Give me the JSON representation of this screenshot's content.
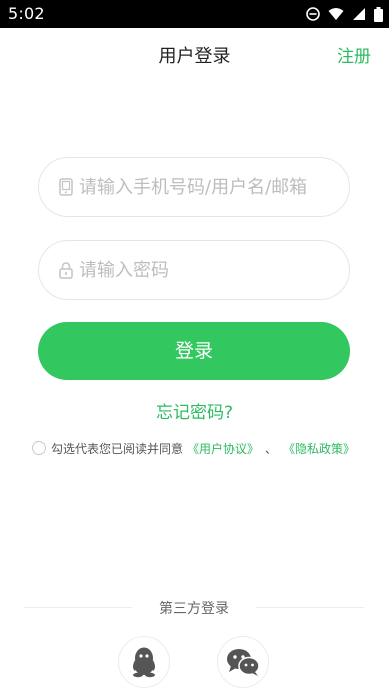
{
  "status_bar": {
    "time": "5:02",
    "icons": [
      "dnd-icon",
      "wifi-icon",
      "signal-icon",
      "battery-icon"
    ]
  },
  "header": {
    "title": "用户登录",
    "register_label": "注册"
  },
  "form": {
    "account_placeholder": "请输入手机号码/用户名/邮箱",
    "account_value": "",
    "password_placeholder": "请输入密码",
    "password_value": "",
    "login_label": "登录",
    "forgot_label": "忘记密码?"
  },
  "agreement": {
    "checked": false,
    "text": "勾选代表您已阅读并同意",
    "user_agreement_link": "《用户协议》",
    "separator": "、",
    "privacy_link": "《隐私政策》"
  },
  "third_party": {
    "label": "第三方登录",
    "providers": [
      "qq-icon",
      "wechat-icon"
    ]
  },
  "colors": {
    "accent": "#33c760",
    "link": "#2dbb62",
    "status_bar": "#000000"
  }
}
